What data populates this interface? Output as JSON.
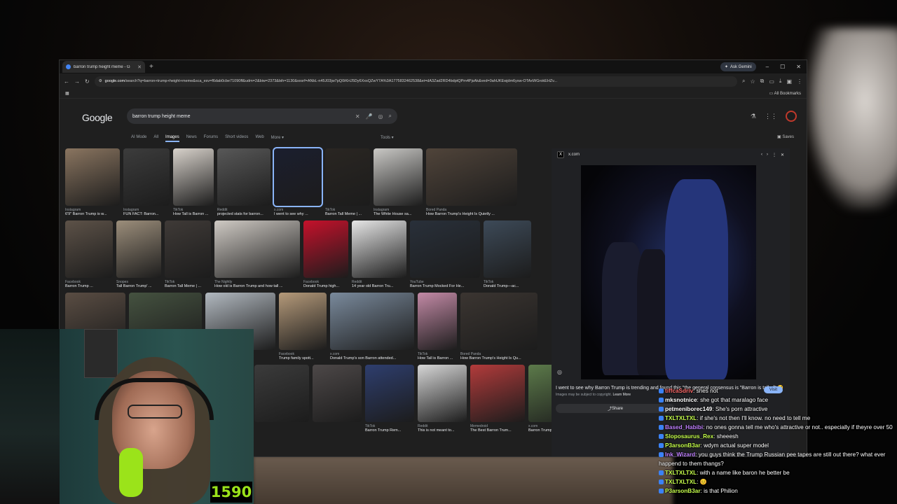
{
  "browser": {
    "tab_title": "barron trump height meme - G",
    "ask_gemini": "Ask Gemini",
    "url_host": "google.com",
    "url_rest": "/search?q=barron+trump+height+meme&sca_esv=f6dab0cbe71090ff&udm=2&biw=2373&bih=1130&sxsrf=ANbL-n45J03jw7pQ0iKHJ5Dy6XxsQZwY7A%3A1775832462538&ei=dA3Zad2RD4bdptQPm4PjsAk&ved=0ahUKEwjdm6ysw-OTAxWGrokEHZv...",
    "all_bookmarks": "All Bookmarks"
  },
  "google": {
    "logo": "Google",
    "query": "barron trump height meme",
    "filters": [
      "AI Mode",
      "All",
      "Images",
      "News",
      "Forums",
      "Short videos",
      "Web",
      "More"
    ],
    "tools": "Tools",
    "saves": "Saves"
  },
  "results": {
    "rows": [
      [
        {
          "src": "Instagram",
          "cap": "6'9\" Barron Trump is w...",
          "w": 78,
          "color": "#8a7560"
        },
        {
          "src": "Instagram",
          "cap": "FUN FACT: Barron...",
          "w": 66,
          "color": "#3c3c3c"
        },
        {
          "src": "TikTok",
          "cap": "How Tall is Barron ...",
          "w": 58,
          "color": "#d8d2cb"
        },
        {
          "src": "Reddit",
          "cap": "projected stats for barron...",
          "w": 76,
          "color": "#585858"
        },
        {
          "src": "x.com",
          "cap": "I went to see why ...",
          "w": 68,
          "color": "#1b1e2e",
          "selected": true
        },
        {
          "src": "TikTok",
          "cap": "Barron Tall Meme | ...",
          "w": 64,
          "color": "#2a2622"
        },
        {
          "src": "Instagram",
          "cap": "The White House sa...",
          "w": 70,
          "color": "#c9c8c5"
        },
        {
          "src": "Bored Panda",
          "cap": "How Barron Trump's Height Is Quietly ...",
          "w": 130,
          "color": "#50443a"
        }
      ],
      [
        {
          "src": "Facebook",
          "cap": "Barron Trump ...",
          "w": 68,
          "color": "#5d5248"
        },
        {
          "src": "Snopes",
          "cap": "Tall Barron Trump' ...",
          "w": 64,
          "color": "#9c8e7b"
        },
        {
          "src": "TikTok",
          "cap": "Barron Tall Meme | ...",
          "w": 66,
          "color": "#3f3a37"
        },
        {
          "src": "The Nightly",
          "cap": "How old is Barron Trump and how tall ...",
          "w": 122,
          "color": "#cfcac4"
        },
        {
          "src": "Facebook",
          "cap": "Donald Trump high...",
          "w": 64,
          "color": "#c5112b"
        },
        {
          "src": "Reddit",
          "cap": "14 year old Barron Tru...",
          "w": 78,
          "color": "#e6e6e6"
        },
        {
          "src": "YouTube",
          "cap": "Barron Trump Mocked For He...",
          "w": 100,
          "color": "#29303a"
        },
        {
          "src": "TikTok",
          "cap": "Donald Trump—ac...",
          "w": 68,
          "color": "#3d4a58"
        }
      ],
      [
        {
          "src": "",
          "cap": "",
          "w": 86,
          "color": "#5a4d43"
        },
        {
          "src": "",
          "cap": "",
          "w": 104,
          "color": "#455240"
        },
        {
          "src": "",
          "cap": "",
          "w": 100,
          "color": "#b2b9c0"
        },
        {
          "src": "Facebook",
          "cap": "Trump family spott...",
          "w": 68,
          "color": "#b59a7a"
        },
        {
          "src": "x.com",
          "cap": "Donald Trump's son Barron attended...",
          "w": 120,
          "color": "#7a8a9c"
        },
        {
          "src": "TikTok",
          "cap": "How Tall is Barron ...",
          "w": 56,
          "color": "#c38aa6"
        },
        {
          "src": "Bored Panda",
          "cap": "How Barron Trump's Height Is Qu...",
          "w": 110,
          "color": "#3b3531"
        }
      ],
      [
        {
          "src": "",
          "cap": "",
          "w": 78,
          "color": "#3b3b3b"
        },
        {
          "src": "",
          "cap": "",
          "w": 70,
          "color": "#4d4848"
        },
        {
          "src": "TikTok",
          "cap": "Barron Trump Rem...",
          "w": 70,
          "color": "#2e3e6e"
        },
        {
          "src": "Reddit",
          "cap": "This is not meant to...",
          "w": 70,
          "color": "#d6d6d6"
        },
        {
          "src": "Memedroid",
          "cap": "The Best Barron Trum...",
          "w": 78,
          "color": "#b23b3b"
        },
        {
          "src": "x.com",
          "cap": "Barron Trump getting ridicu...",
          "w": 90,
          "color": "#5c7a4a"
        }
      ]
    ]
  },
  "preview": {
    "source": "x.com",
    "caption": "I went to see why Barron Trump is trending and found this \"the general consensus is \"Barron is tall af\" 😭",
    "copyright": "Images may be subject to copyright.",
    "learn_more": "Learn More",
    "visit": "Visit",
    "share": "Share"
  },
  "stream": {
    "counter": "1590"
  },
  "chat": [
    {
      "user": "tiffcaSdriv",
      "text": "shes not",
      "color": "#ff6b6b",
      "badge": "#3b82f6"
    },
    {
      "user": "mksnotnice",
      "text": "she got that maralago face",
      "color": "#ffffff",
      "badge": "#3b82f6"
    },
    {
      "user": "petmeniborec149",
      "text": "She's porn attractive",
      "color": "#ffffff",
      "badge": "#3b82f6"
    },
    {
      "user": "TXLTXLTXL",
      "text": "if she's not then I'll know. no need to tell me",
      "color": "#c6ff4b",
      "badge": "#3b82f6"
    },
    {
      "user": "Based_Habibi",
      "text": "no ones gonna tell me who's attractive or not.. especially if theyre over 50",
      "color": "#c080ff",
      "badge": "#3b82f6"
    },
    {
      "user": "Sloposaurus_Rex",
      "text": "sheeesh",
      "color": "#c6ff4b",
      "badge": "#3b82f6"
    },
    {
      "user": "P3arsonB3ar",
      "text": "wdym actual super model",
      "color": "#c6ff4b",
      "badge": "#3b82f6"
    },
    {
      "user": "Ink_Wizard",
      "text": "you guys think the Trump Russian pee tapes are still out there? what ever happend to them thangs?",
      "color": "#c080ff",
      "badge": "#3b82f6"
    },
    {
      "user": "TXLTXLTXL",
      "text": "with a name like baron he better be",
      "color": "#c6ff4b",
      "badge": "#3b82f6"
    },
    {
      "user": "TXLTXLTXL",
      "text": "😊",
      "color": "#c6ff4b",
      "badge": "#3b82f6"
    },
    {
      "user": "P3arsonB3ar",
      "text": "is that Philion",
      "color": "#c6ff4b",
      "badge": "#3b82f6"
    }
  ]
}
